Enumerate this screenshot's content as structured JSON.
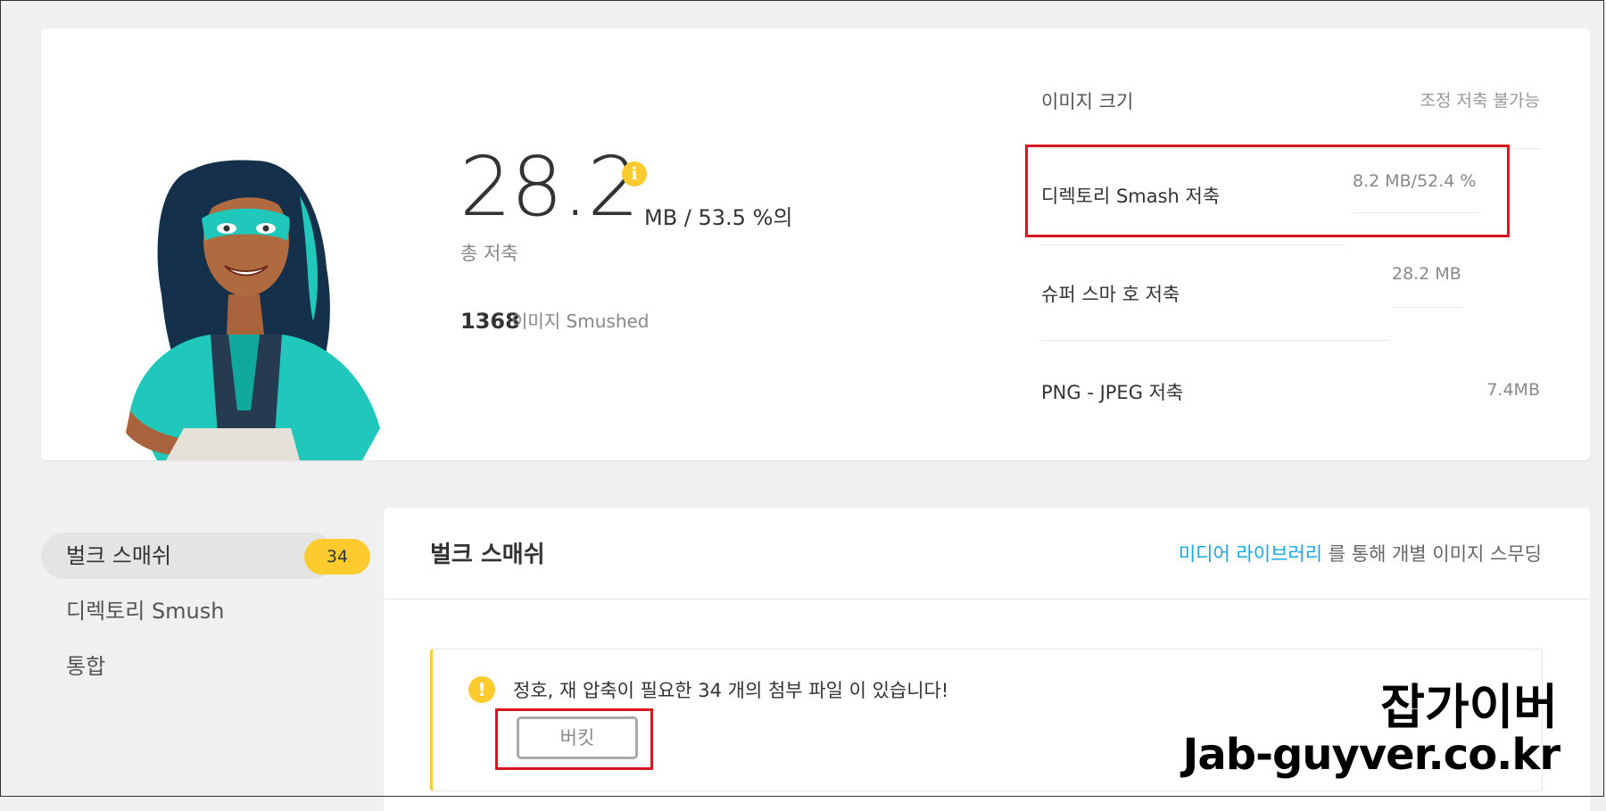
{
  "summary": {
    "total_savings_value": "28.2",
    "total_savings_unit": "MB / 53.5 %의",
    "total_savings_label": "총 저축",
    "images_count": "1368",
    "images_label": "이미지 Smushed",
    "stats": [
      {
        "label": "이미지 크기",
        "value": "조정 저축 불가능"
      },
      {
        "label": "디렉토리 Smash 저축",
        "value": "8.2 MB/52.4 %"
      },
      {
        "label": "슈퍼 스마 호 저축",
        "value": "28.2 MB"
      },
      {
        "label": "PNG - JPEG 저축",
        "value": "7.4MB"
      }
    ]
  },
  "sidebar": {
    "items": [
      {
        "label": "벌크 스매쉬",
        "badge": "34"
      },
      {
        "label": "디렉토리 Smush"
      },
      {
        "label": "통합"
      }
    ]
  },
  "bulk": {
    "title": "벌크 스매쉬",
    "media_link": "미디어 라이브러리",
    "media_suffix": " 를 통해 개별 이미지 스무딩",
    "notice_text": "정호, 재 압축이 필요한 34 개의 첨부 파일 이 있습니다!",
    "bucket_button": "버킷"
  },
  "watermark": {
    "line1": "잡가이버",
    "line2": "Jab-guyver.co.kr"
  },
  "colors": {
    "accent": "#fecb2f",
    "link": "#17a8e3",
    "highlight": "#d9161f"
  }
}
